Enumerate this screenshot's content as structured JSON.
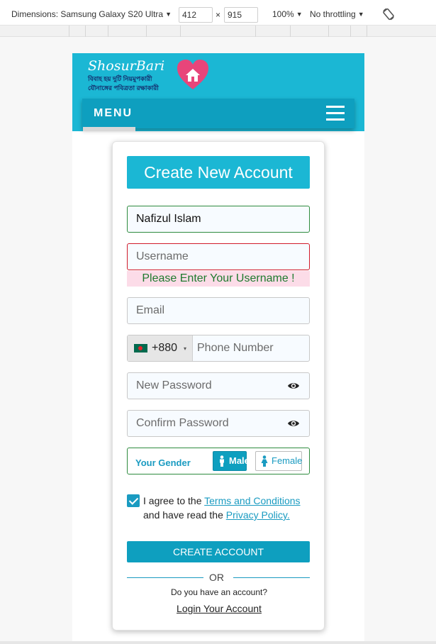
{
  "devtools": {
    "dimensions_label": "Dimensions: Samsung Galaxy S20 Ultra",
    "width": "412",
    "times": "×",
    "height": "915",
    "zoom": "100%",
    "throttling": "No throttling",
    "caret": "▼"
  },
  "header": {
    "logo_title": "ShosurBari",
    "logo_line1": "বিবাহ হয় দুটি নিয়মুপকারী",
    "logo_line2": "যৌনাঙ্গের পবিত্রতা রক্ষাকারী",
    "menu_label": "MENU"
  },
  "form": {
    "title": "Create New Account",
    "name_value": "Nafizul Islam",
    "username_placeholder": "Username",
    "username_error": "Please Enter Your Username !",
    "email_placeholder": "Email",
    "dial_code": "+880",
    "dial_caret": "▾",
    "phone_placeholder": "Phone Number",
    "new_password_placeholder": "New Password",
    "confirm_password_placeholder": "Confirm Password",
    "gender_label": "Your Gender",
    "gender_male": "Male",
    "gender_female": "Female",
    "agree_prefix": "I agree to the ",
    "terms_link": "Terms and Conditions",
    "agree_middle": " and have read the ",
    "privacy_link": "Privacy Policy.",
    "create_button": "CREATE ACCOUNT",
    "or_text": "OR",
    "have_account": "Do you have an account?",
    "login_link": "Login Your Account"
  },
  "colors": {
    "primary": "#1bb7d4",
    "primary_dark": "#0e9fbf",
    "error_border": "#d11a2a",
    "valid_border": "#2e8b3e"
  }
}
